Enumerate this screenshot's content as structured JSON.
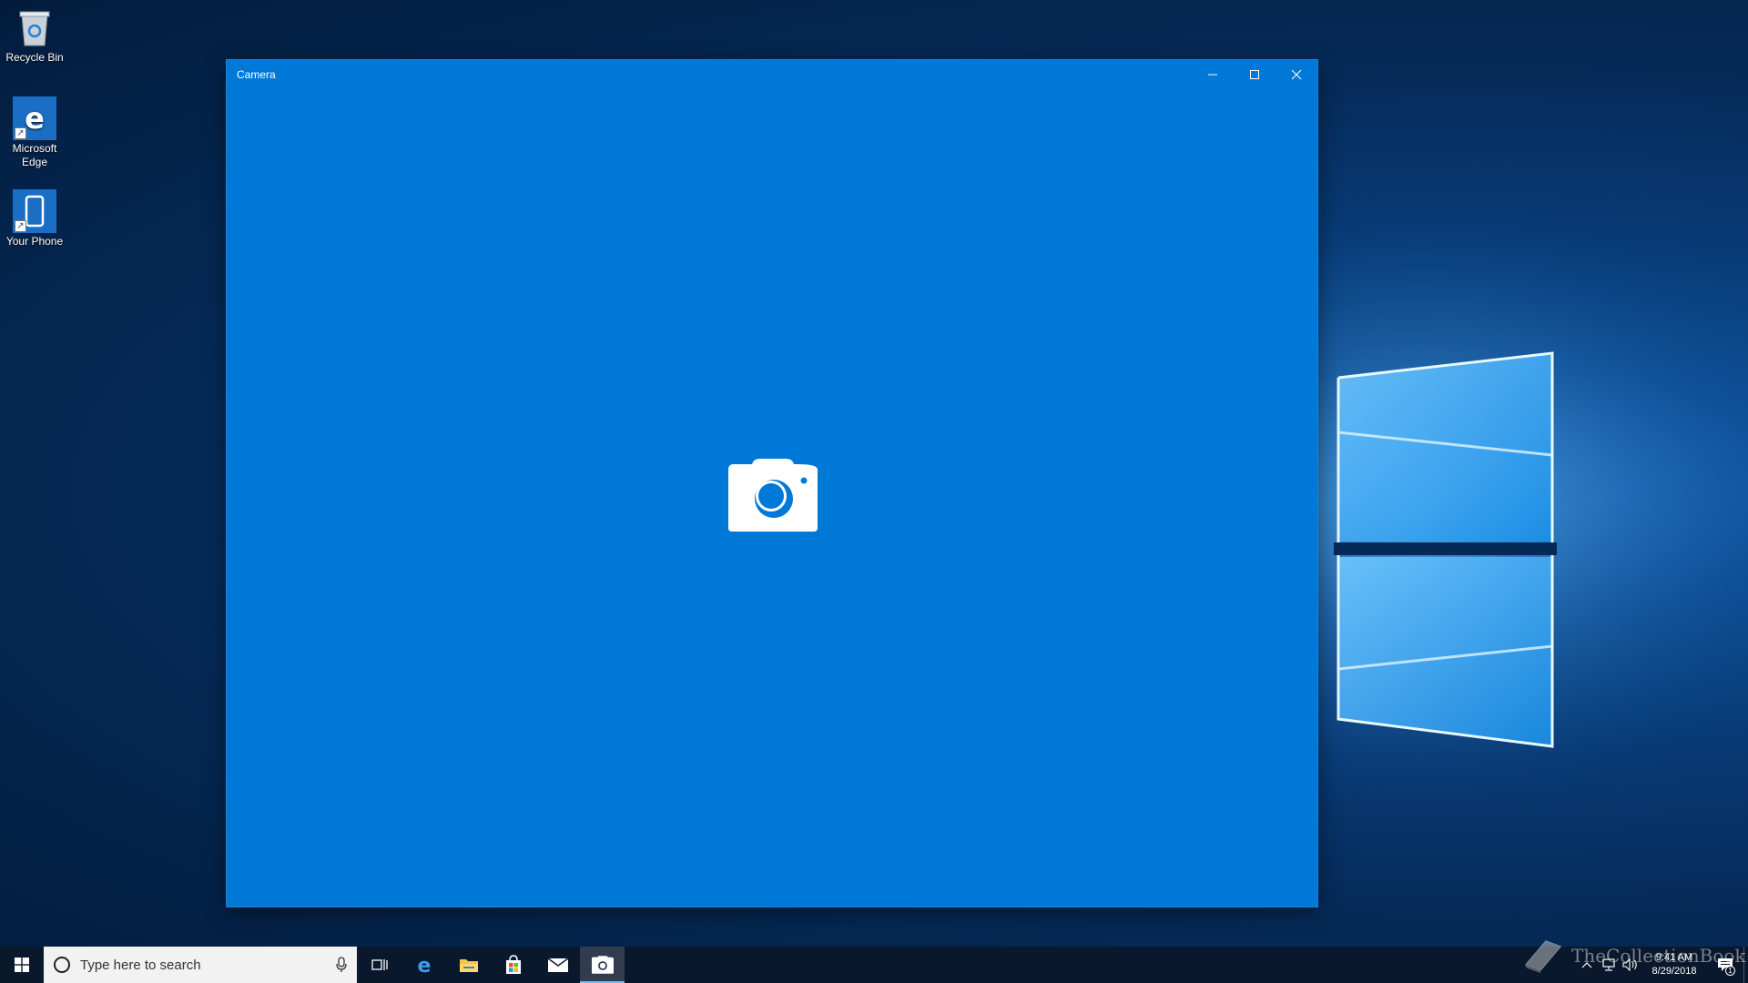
{
  "desktop": {
    "icons": [
      {
        "label": "Recycle Bin"
      },
      {
        "label": "Microsoft Edge"
      },
      {
        "label": "Your Phone"
      }
    ]
  },
  "camera_window": {
    "title": "Camera",
    "controls": {
      "minimize": "minimize-icon",
      "maximize": "maximize-icon",
      "close": "close-icon"
    },
    "content_icon": "camera-icon",
    "background_color": "#0078d7"
  },
  "taskbar": {
    "search": {
      "placeholder": "Type here to search"
    },
    "apps": [
      {
        "name": "task-view-icon"
      },
      {
        "name": "edge-icon"
      },
      {
        "name": "file-explorer-icon"
      },
      {
        "name": "store-icon"
      },
      {
        "name": "mail-icon"
      },
      {
        "name": "camera-icon",
        "active": true
      }
    ],
    "clock": {
      "time": "9:41 AM",
      "date": "8/29/2018"
    },
    "notifications": {
      "count": "1"
    }
  },
  "watermark": {
    "text": "TheCollectionBook"
  }
}
